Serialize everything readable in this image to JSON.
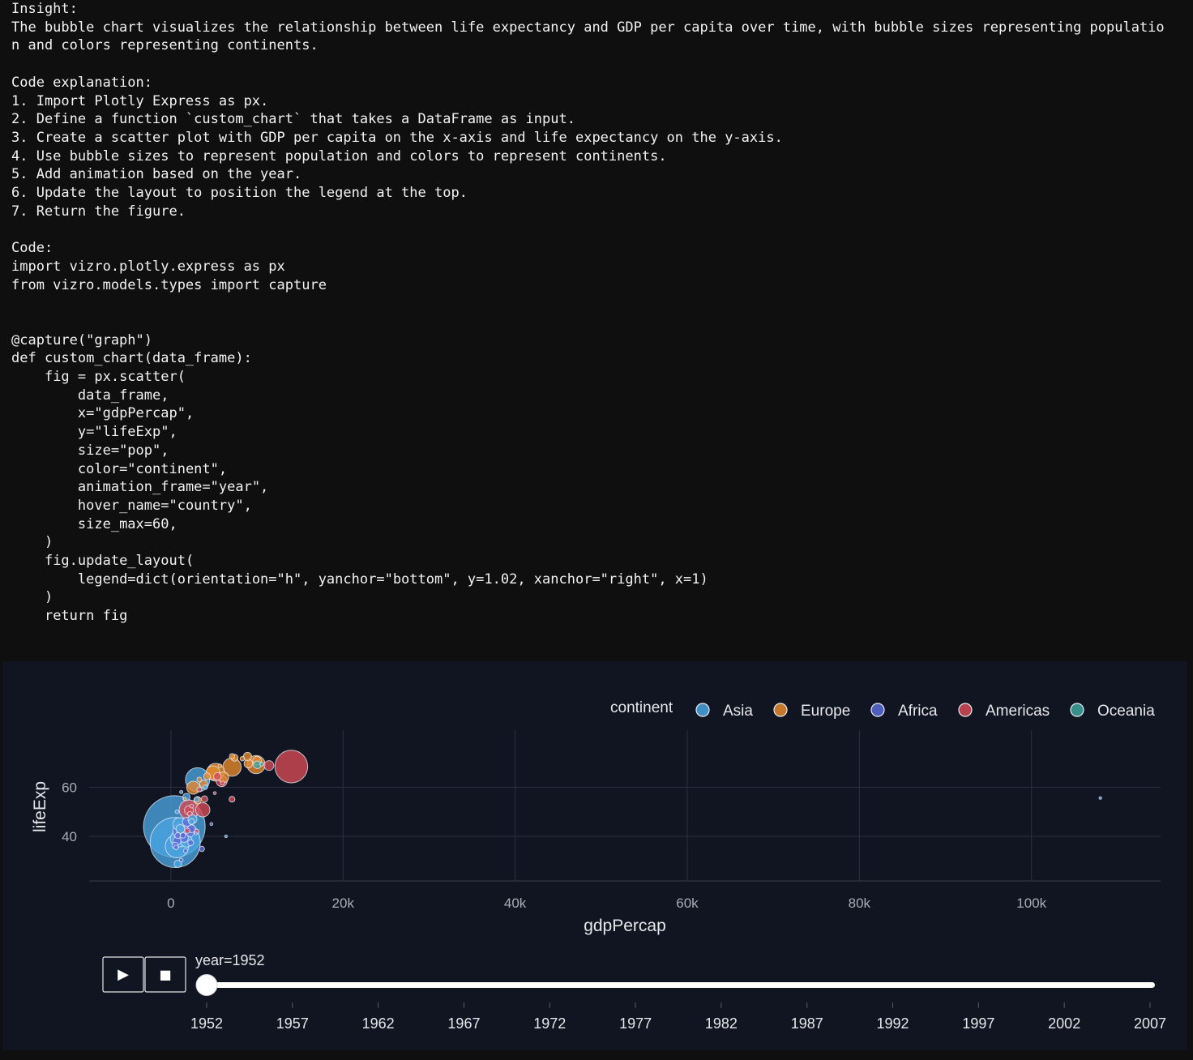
{
  "text_lines": [
    "Insight:",
    "The bubble chart visualizes the relationship between life expectancy and GDP per capita over time, with bubble sizes representing populatio",
    "n and colors representing continents.",
    "",
    "Code explanation:",
    "1. Import Plotly Express as px.",
    "2. Define a function `custom_chart` that takes a DataFrame as input.",
    "3. Create a scatter plot with GDP per capita on the x-axis and life expectancy on the y-axis.",
    "4. Use bubble sizes to represent population and colors to represent continents.",
    "5. Add animation based on the year.",
    "6. Update the layout to position the legend at the top.",
    "7. Return the figure.",
    "",
    "Code:",
    "import vizro.plotly.express as px",
    "from vizro.models.types import capture",
    "",
    "",
    "@capture(\"graph\")",
    "def custom_chart(data_frame):",
    "    fig = px.scatter(",
    "        data_frame,",
    "        x=\"gdpPercap\",",
    "        y=\"lifeExp\",",
    "        size=\"pop\",",
    "        color=\"continent\",",
    "        animation_frame=\"year\",",
    "        hover_name=\"country\",",
    "        size_max=60,",
    "    )",
    "    fig.update_layout(",
    "        legend=dict(orientation=\"h\", yanchor=\"bottom\", y=1.02, xanchor=\"right\", x=1)",
    "    )",
    "    return fig"
  ],
  "chart_data": {
    "type": "scatter",
    "xlabel": "gdpPercap",
    "ylabel": "lifeExp",
    "xlim": [
      -9500,
      115000
    ],
    "ylim": [
      22.2,
      83.2
    ],
    "x_ticks": [
      0,
      20000,
      40000,
      60000,
      80000,
      100000
    ],
    "x_tick_labels": [
      "0",
      "20k",
      "40k",
      "60k",
      "80k",
      "100k"
    ],
    "y_ticks": [
      40,
      60
    ],
    "y_tick_labels": [
      "40",
      "60"
    ],
    "grid": true,
    "legend_title": "continent",
    "legend_position": "top-right",
    "series": [
      {
        "name": "Asia",
        "color": "#4aa3df",
        "points": [
          [
            400,
            44,
            560000000.0
          ],
          [
            500,
            37.5,
            370000000.0
          ],
          [
            700,
            36,
            80000000.0
          ],
          [
            900,
            39,
            40000000.0
          ],
          [
            1500,
            41,
            30000000.0
          ],
          [
            1000,
            45,
            25000000.0
          ],
          [
            2500,
            47,
            12000000.0
          ],
          [
            3100,
            63,
            86000000.0
          ],
          [
            1800,
            56,
            8000000.0
          ],
          [
            3000,
            55,
            4000000.0
          ],
          [
            6400,
            40,
            1000000.0
          ],
          [
            1200,
            58,
            1500000.0
          ],
          [
            700,
            50,
            2000000.0
          ],
          [
            1100,
            43,
            11000000.0
          ],
          [
            108000,
            55.6,
            160000.0
          ],
          [
            4000,
            60,
            3000000.0
          ],
          [
            800,
            28.8,
            8000000.0
          ],
          [
            1800,
            38,
            20000000.0
          ],
          [
            2400,
            46,
            5000000.0
          ]
        ]
      },
      {
        "name": "Europe",
        "color": "#e58a2e",
        "points": [
          [
            7100,
            68.2,
            50000000.0
          ],
          [
            9900,
            69.2,
            49000000.0
          ],
          [
            5200,
            66.1,
            47000000.0
          ],
          [
            4900,
            65.9,
            28000000.0
          ],
          [
            8900,
            72.5,
            10000000.0
          ],
          [
            7400,
            72,
            7000000.0
          ],
          [
            9000,
            69.6,
            11000000.0
          ],
          [
            10000,
            70.8,
            11000000.0
          ],
          [
            6100,
            64,
            17000000.0
          ],
          [
            3800,
            61.3,
            9000000.0
          ],
          [
            2600,
            59.8,
            25000000.0
          ],
          [
            4200,
            64.4,
            7000000.0
          ],
          [
            3300,
            63.1,
            3500000.0
          ],
          [
            3100,
            54.7,
            8000000.0
          ],
          [
            1600,
            55.2,
            1300000.0
          ],
          [
            5700,
            68.7,
            2000000.0
          ],
          [
            8300,
            71.6,
            3000000.0
          ],
          [
            7100,
            72.6,
            4000000.0
          ]
        ]
      },
      {
        "name": "Africa",
        "color": "#5a6ad8",
        "points": [
          [
            2400,
            43.1,
            9000000.0
          ],
          [
            4700,
            45,
            1300000.0
          ],
          [
            2000,
            41.9,
            22000000.0
          ],
          [
            1500,
            39.4,
            12000000.0
          ],
          [
            1100,
            42.1,
            33000000.0
          ],
          [
            700,
            38.2,
            10000000.0
          ],
          [
            600,
            35.5,
            3000000.0
          ],
          [
            1400,
            40.4,
            4500000.0
          ],
          [
            2300,
            37.4,
            5000000.0
          ],
          [
            3600,
            34.9,
            4000000.0
          ],
          [
            1200,
            30.3,
            2000000.0
          ],
          [
            800,
            40.3,
            5000000.0
          ],
          [
            500,
            36.3,
            6000000.0
          ],
          [
            1900,
            45.9,
            13000000.0
          ],
          [
            2900,
            41.2,
            1000000.0
          ],
          [
            1700,
            34.1,
            2500000.0
          ]
        ]
      },
      {
        "name": "Americas",
        "color": "#d34a55",
        "points": [
          [
            13990,
            68.4,
            158000000.0
          ],
          [
            2100,
            50.9,
            56000000.0
          ],
          [
            3700,
            50.8,
            30000000.0
          ],
          [
            5900,
            62.5,
            18000000.0
          ],
          [
            11400,
            68.8,
            14000000.0
          ],
          [
            2100,
            50.6,
            12000000.0
          ],
          [
            7100,
            55.1,
            5000000.0
          ],
          [
            5400,
            64.4,
            8500000.0
          ],
          [
            3900,
            55.2,
            6000000.0
          ],
          [
            3300,
            59.1,
            3500000.0
          ],
          [
            2200,
            49.2,
            3000000.0
          ],
          [
            1900,
            42.3,
            4000000.0
          ],
          [
            2400,
            52.3,
            2000000.0
          ],
          [
            5100,
            57.6,
            1200000.0
          ],
          [
            6000,
            61.7,
            2400000.0
          ],
          [
            3000,
            42.0,
            3100000.0
          ]
        ]
      },
      {
        "name": "Oceania",
        "color": "#3fa39b",
        "points": [
          [
            10040,
            69.1,
            8700000.0
          ],
          [
            10550,
            69.4,
            1990000.0
          ]
        ]
      }
    ]
  },
  "slider": {
    "current_label": "year=1952",
    "years": [
      "1952",
      "1957",
      "1962",
      "1967",
      "1972",
      "1977",
      "1982",
      "1987",
      "1992",
      "1997",
      "2002",
      "2007"
    ],
    "current_index": 0,
    "play_symbol": "▶",
    "stop_symbol": "■"
  }
}
